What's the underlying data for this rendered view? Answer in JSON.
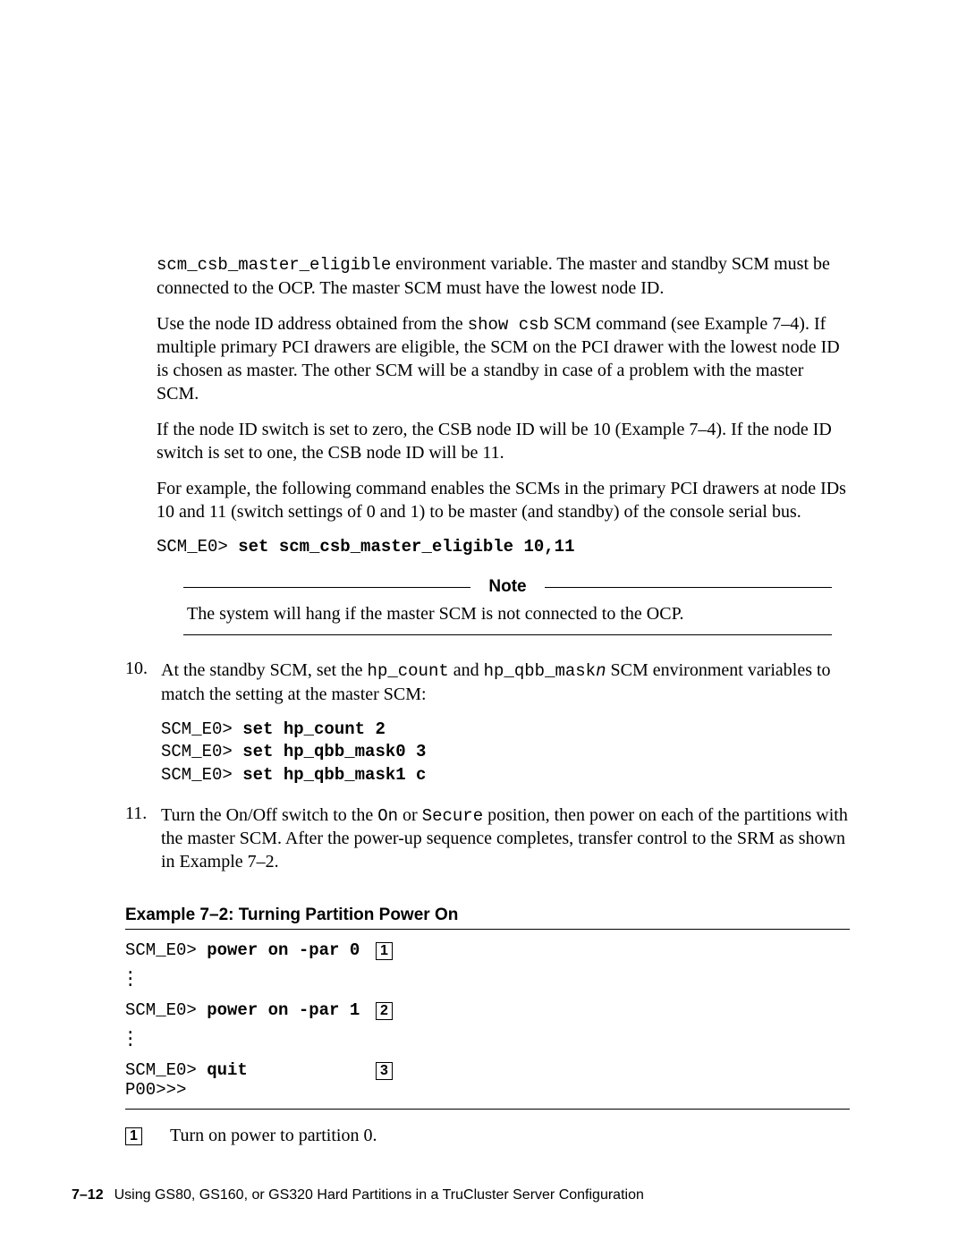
{
  "para1a": "scm_csb_master_eligible",
  "para1b": " environment variable. The master and standby SCM must be connected to the OCP. The master SCM must have the lowest node ID.",
  "para2a": "Use the node ID address obtained from the ",
  "para2b": "show csb",
  "para2c": " SCM command (see Example 7–4). If multiple primary PCI drawers are eligible, the SCM on the PCI drawer with the lowest node ID is chosen as master. The other SCM will be a standby in case of a problem with the master SCM.",
  "para3": "If the node ID switch is set to zero, the CSB node ID will be 10 (Example 7–4). If the node ID switch is set to one, the CSB node ID will be 11.",
  "para4": "For example, the following command enables the SCMs in the primary PCI drawers at node IDs 10 and 11 (switch settings of 0 and 1) to be master (and standby) of the console serial bus.",
  "cmd1_prompt": "SCM_E0> ",
  "cmd1_cmd": "set scm_csb_master_eligible 10,11",
  "note_label": "Note",
  "note_text": "The system will hang if the master SCM is not connected to the OCP.",
  "step10_num": "10.",
  "step10a": "At the standby SCM, set the ",
  "step10b": "hp_count",
  "step10c": " and ",
  "step10d": "hp_qbb_mask",
  "step10e": "n",
  "step10f": " SCM environment variables to match the setting at the master SCM:",
  "s10_cmds": [
    {
      "p": "SCM_E0> ",
      "c": "set hp_count 2"
    },
    {
      "p": "SCM_E0> ",
      "c": "set hp_qbb_mask0 3"
    },
    {
      "p": "SCM_E0> ",
      "c": "set hp_qbb_mask1 c"
    }
  ],
  "step11_num": "11.",
  "step11a": "Turn the On/Off switch to the ",
  "step11b": "On",
  "step11c": " or ",
  "step11d": "Secure",
  "step11e": " position, then power on each of the partitions with the master SCM. After the power-up sequence completes, transfer control to the SRM as shown in Example 7–2.",
  "example_title": "Example 7–2: Turning Partition Power On",
  "ex": {
    "r1": {
      "p": "SCM_E0> ",
      "c": "power on -par 0",
      "n": "1"
    },
    "r2": {
      "p": "SCM_E0> ",
      "c": "power on -par 1",
      "n": "2"
    },
    "r3": {
      "p": "SCM_E0> ",
      "c": "quit",
      "n": "3"
    },
    "r4": {
      "p": "P00>>>"
    }
  },
  "cl1_n": "1",
  "cl1_t": "Turn on power to partition 0.",
  "footer_page": "7–12",
  "footer_text": "Using GS80, GS160, or GS320 Hard Partitions in a TruCluster Server Configuration"
}
